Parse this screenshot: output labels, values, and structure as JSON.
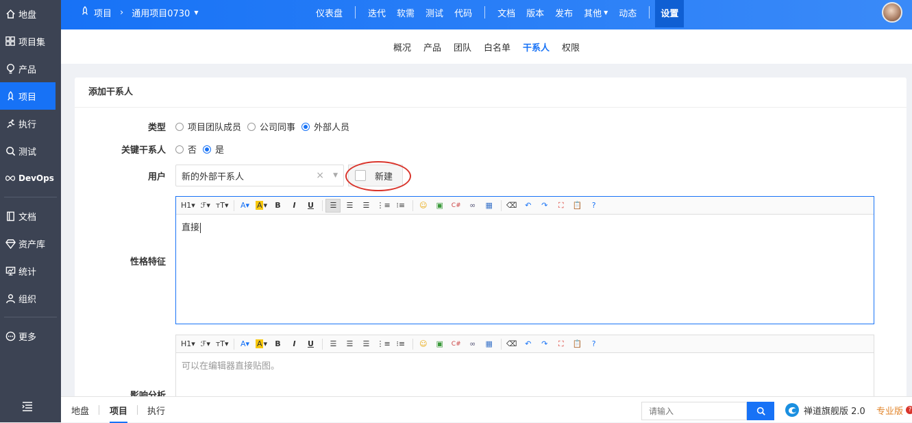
{
  "sidebar": {
    "items": [
      {
        "label": "地盘",
        "icon": "home-icon"
      },
      {
        "label": "项目集",
        "icon": "grid-icon"
      },
      {
        "label": "产品",
        "icon": "lightbulb-icon"
      },
      {
        "label": "项目",
        "icon": "rocket-icon",
        "active": true
      },
      {
        "label": "执行",
        "icon": "runner-icon"
      },
      {
        "label": "测试",
        "icon": "magnifier-icon"
      },
      {
        "label": "DevOps",
        "icon": "infinity-icon"
      },
      {
        "label": "文档",
        "icon": "book-icon"
      },
      {
        "label": "资产库",
        "icon": "diamond-icon"
      },
      {
        "label": "统计",
        "icon": "chart-board-icon"
      },
      {
        "label": "组织",
        "icon": "people-icon"
      },
      {
        "label": "更多",
        "icon": "more-icon"
      }
    ],
    "toggle_icon": "menu-collapse-icon"
  },
  "topbar": {
    "module": "项目",
    "project": "通用项目0730",
    "nav": [
      "仪表盘",
      "迭代",
      "软需",
      "测试",
      "代码",
      "文档",
      "版本",
      "发布",
      "其他",
      "动态",
      "设置"
    ],
    "active": "设置"
  },
  "subnav": {
    "items": [
      "概况",
      "产品",
      "团队",
      "白名单",
      "干系人",
      "权限"
    ],
    "active": "干系人"
  },
  "form": {
    "title": "添加干系人",
    "type_label": "类型",
    "type_options": [
      "项目团队成员",
      "公司同事",
      "外部人员"
    ],
    "type_selected": "外部人员",
    "key_label": "关键干系人",
    "key_options": [
      "否",
      "是"
    ],
    "key_selected": "是",
    "user_label": "用户",
    "user_value": "新的外部干系人",
    "new_label": "新建",
    "nature_label": "性格特征",
    "nature_value": "直接",
    "analysis_label": "影响分析",
    "analysis_placeholder": "可以在编辑器直接贴图。",
    "annotation_color": "#d9342b"
  },
  "editor_toolbar": {
    "heading": "H1",
    "font": "ℱ",
    "size": "тT"
  },
  "bottombar": {
    "tabs": [
      "地盘",
      "项目",
      "执行"
    ],
    "active": "项目",
    "search_placeholder": "请输入",
    "brand": "禅道旗舰版 2.0",
    "edition": "专业版"
  },
  "colors": {
    "primary": "#1772f6",
    "sidebar": "#3c4353",
    "accent_orange": "#e2852b"
  }
}
